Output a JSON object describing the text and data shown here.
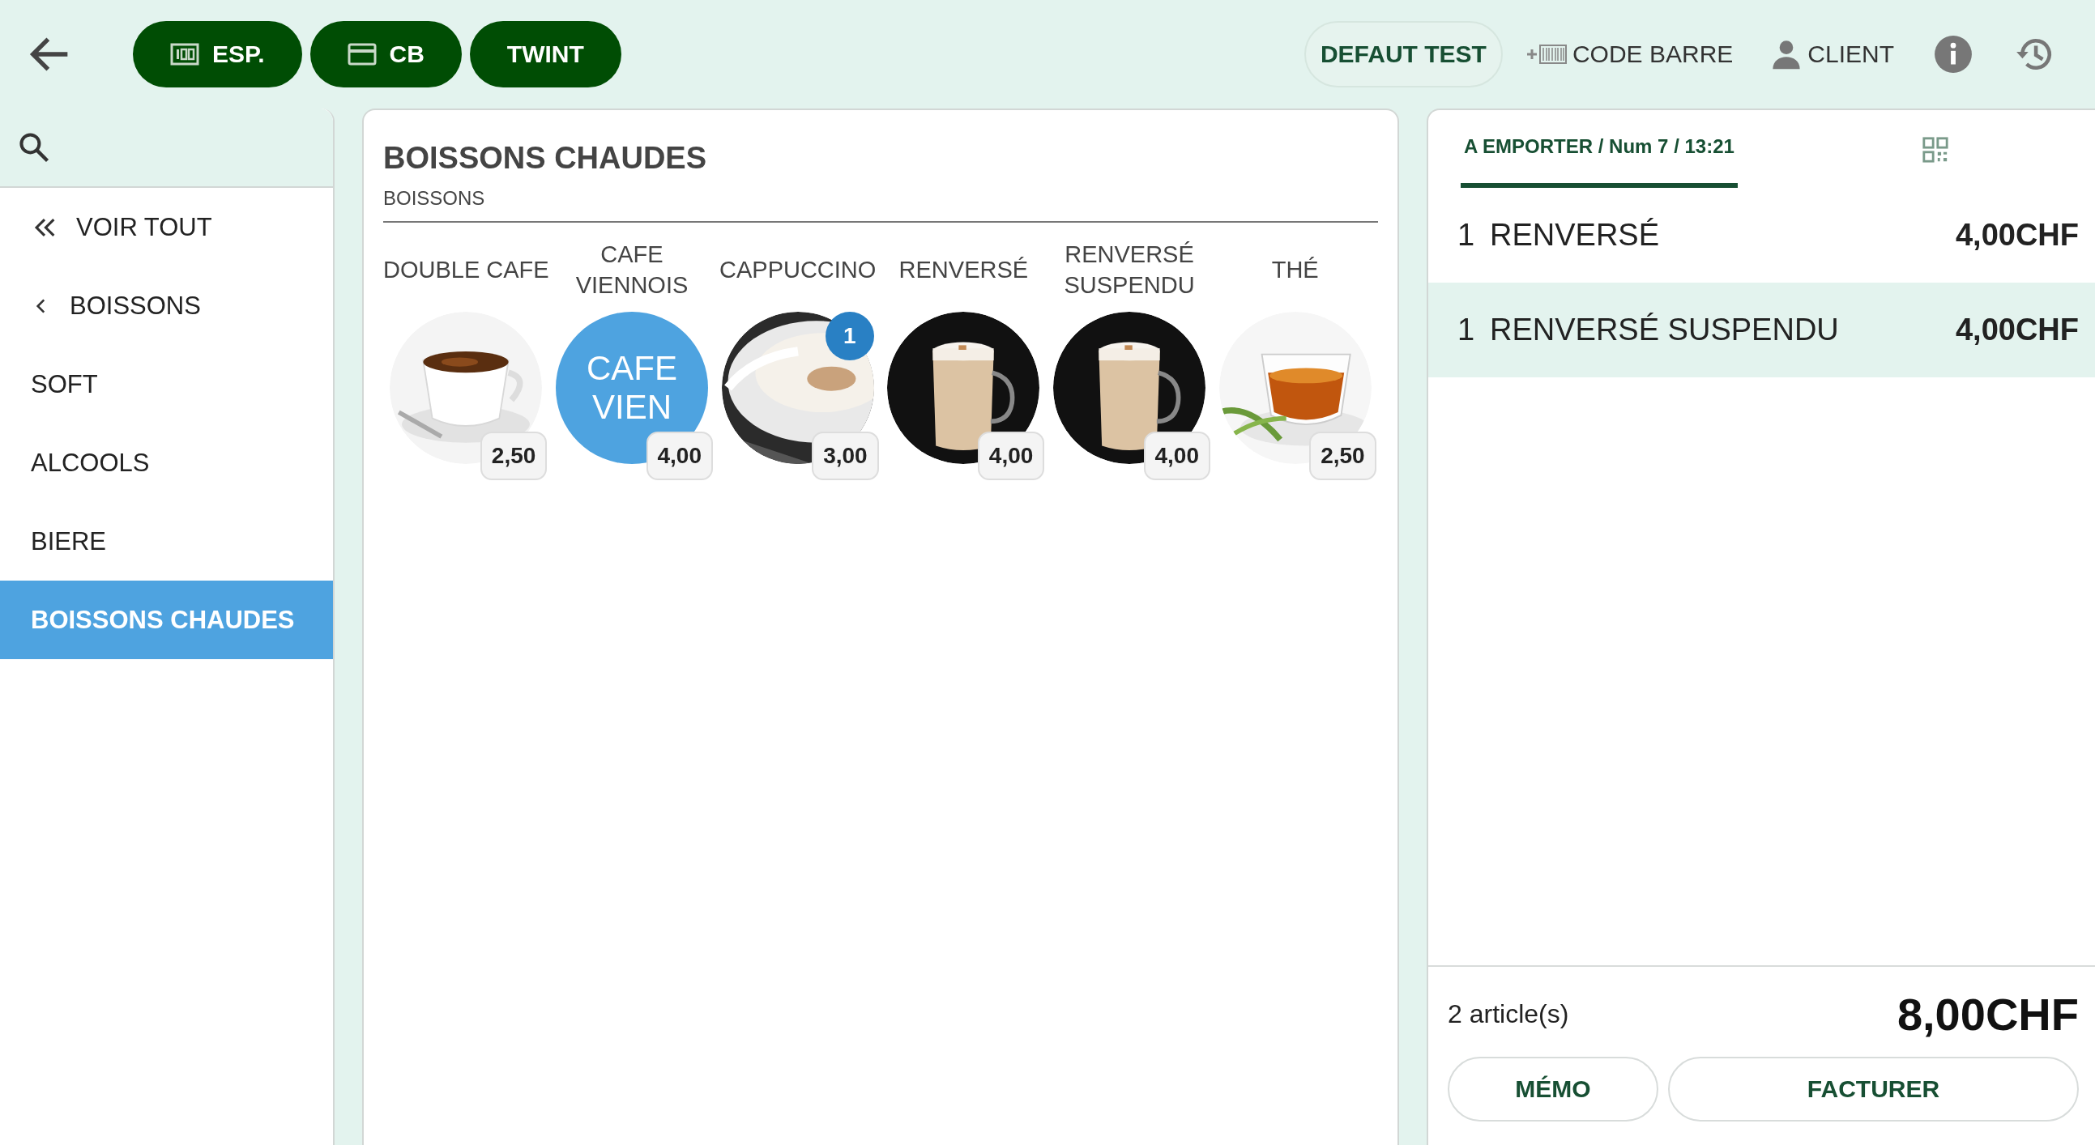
{
  "toolbar": {
    "payment_buttons": [
      {
        "label": "ESP.",
        "kind": "cash"
      },
      {
        "label": "CB",
        "kind": "card"
      },
      {
        "label": "TWINT",
        "kind": "plain"
      }
    ],
    "profile": "DEFAUT TEST",
    "barcode": "CODE BARRE",
    "client": "CLIENT"
  },
  "sidebar": {
    "items": [
      {
        "label": "VOIR TOUT",
        "kind": "all",
        "selected": false
      },
      {
        "label": "BOISSONS",
        "kind": "back",
        "selected": false
      },
      {
        "label": "SOFT",
        "kind": "plain",
        "selected": false
      },
      {
        "label": "ALCOOLS",
        "kind": "plain",
        "selected": false
      },
      {
        "label": "BIERE",
        "kind": "plain",
        "selected": false
      },
      {
        "label": "BOISSONS CHAUDES",
        "kind": "plain",
        "selected": true
      }
    ]
  },
  "category": {
    "title": "BOISSONS CHAUDES",
    "subtitle": "BOISSONS"
  },
  "products": [
    {
      "name": "DOUBLE CAFE",
      "kind": "picture",
      "price": "2,50"
    },
    {
      "name": "CAFE VIENNOIS",
      "kind": "text",
      "tile_text": "CAFE VIEN",
      "price": "4,00"
    },
    {
      "name": "CAPPUCCINO",
      "kind": "picture",
      "price": "3,00",
      "count": "1"
    },
    {
      "name": "RENVERSÉ",
      "kind": "picture",
      "price": "4,00"
    },
    {
      "name": "RENVERSÉ SUSPENDU",
      "kind": "picture",
      "price": "4,00"
    },
    {
      "name": "THÉ",
      "kind": "picture",
      "price": "2,50"
    }
  ],
  "order": {
    "tab": {
      "label": "A EMPORTER / Num 7 / 13:21",
      "selected": true
    },
    "lines": [
      {
        "qty": "1",
        "name": "RENVERSÉ",
        "amount": "4,00CHF",
        "selected": false
      },
      {
        "qty": "1",
        "name": "RENVERSÉ SUSPENDU",
        "amount": "4,00CHF",
        "selected": true
      }
    ],
    "count": "2 article(s)",
    "total": "8,00CHF",
    "buttons": [
      "MÉMO",
      "FACTURER"
    ]
  }
}
